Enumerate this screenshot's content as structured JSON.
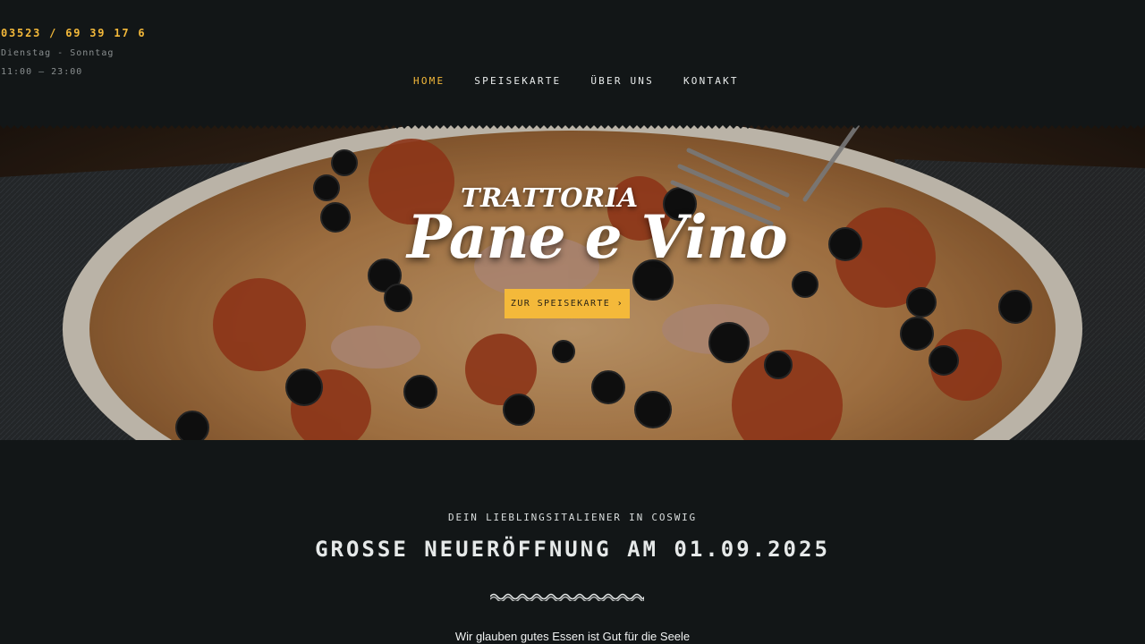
{
  "contact": {
    "phone": "03523 / 69 39 17 6",
    "days": "Dienstag - Sonntag",
    "time": "11:00 – 23:00"
  },
  "nav": {
    "items": [
      {
        "label": "HOME",
        "active": true
      },
      {
        "label": "SPEISEKARTE",
        "active": false
      },
      {
        "label": "ÜBER UNS",
        "active": false
      },
      {
        "label": "KONTAKT",
        "active": false
      }
    ]
  },
  "hero": {
    "title_small": "TRATTORIA",
    "title_big": "Pane e Vino",
    "cta_label": "ZUR SPEISEKARTE ›"
  },
  "intro": {
    "eyebrow": "DEIN LIEBLINGSITALIENER IN COSWIG",
    "headline": "GROSSE NEUERÖFFNUNG AM 01.09.2025",
    "tagline": "Wir glauben gutes Essen ist Gut für die Seele"
  },
  "colors": {
    "accent": "#f4b93a",
    "background": "#121617",
    "text": "#e6e9e9"
  }
}
